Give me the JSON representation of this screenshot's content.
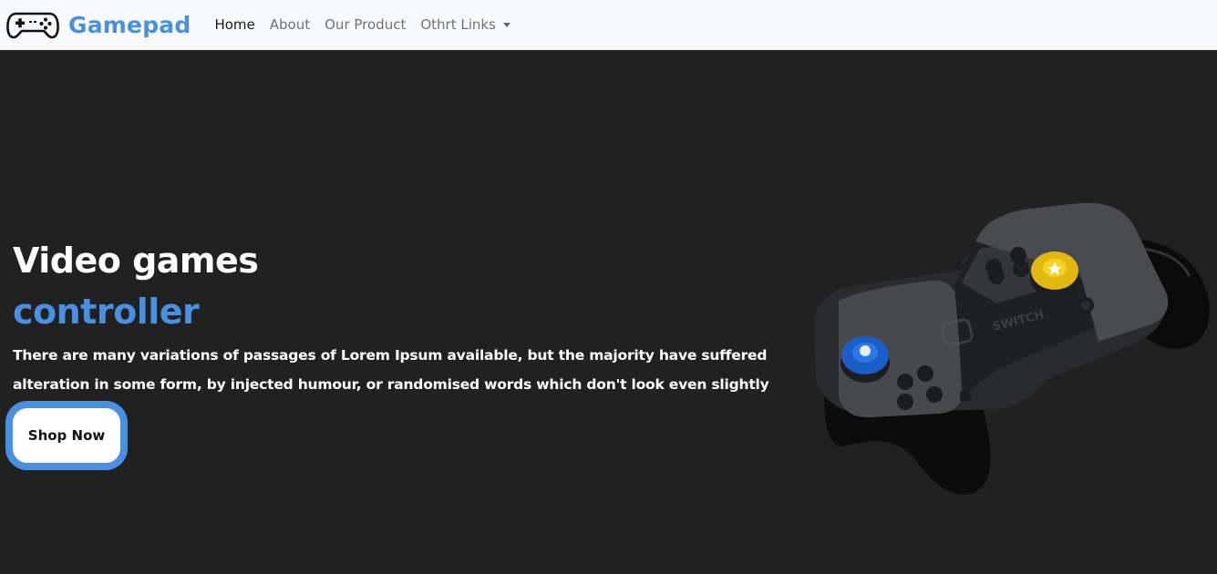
{
  "brand": {
    "name": "Gamepad",
    "icon": "gamepad-icon",
    "color": "#4a90e2"
  },
  "nav": {
    "items": [
      {
        "label": "Home",
        "active": true
      },
      {
        "label": "About",
        "active": false
      },
      {
        "label": "Our Product",
        "active": false
      },
      {
        "label": "Othrt Links",
        "active": false,
        "dropdown": true
      }
    ]
  },
  "hero": {
    "title_line1": "Video games",
    "title_line2": "controller",
    "description": "There are many variations of passages of Lorem Ipsum available, but the majority have suffered alteration in some form, by injected humour, or randomised words which don't look even slightly believable",
    "cta_label": "Shop Now",
    "image": "joy-con-controller-image",
    "accent_color": "#4a90e2",
    "background": "#212121"
  }
}
